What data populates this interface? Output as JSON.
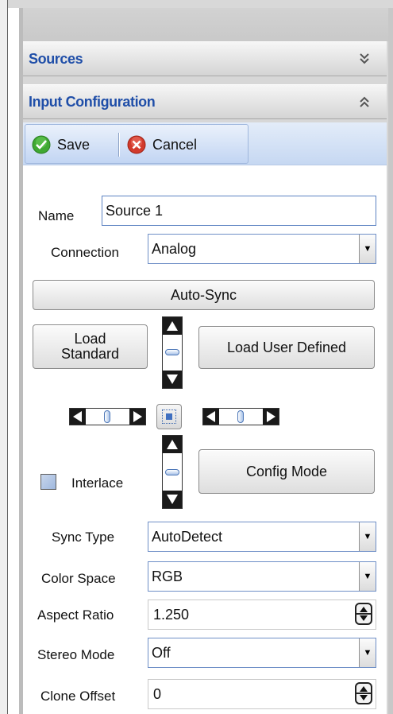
{
  "accordion": {
    "sources": {
      "title": "Sources",
      "icon": "chevron-double-down-icon"
    },
    "input_configuration": {
      "title": "Input Configuration",
      "icon": "chevron-double-up-icon"
    }
  },
  "toolbar": {
    "save_label": "Save",
    "save_icon": "green-check-icon",
    "cancel_label": "Cancel",
    "cancel_icon": "red-x-icon"
  },
  "form": {
    "name_label": "Name",
    "name_value": "Source 1",
    "connection_label": "Connection",
    "connection_value": "Analog",
    "auto_sync_label": "Auto-Sync",
    "load_standard_label_line1": "Load",
    "load_standard_label_line2": "Standard",
    "load_user_defined_label": "Load User Defined",
    "interlace_label": "Interlace",
    "interlace_checked": false,
    "config_mode_label": "Config Mode",
    "sync_type_label": "Sync Type",
    "sync_type_value": "AutoDetect",
    "color_space_label": "Color Space",
    "color_space_value": "RGB",
    "aspect_ratio_label": "Aspect Ratio",
    "aspect_ratio_value": "1.250",
    "stereo_mode_label": "Stereo Mode",
    "stereo_mode_value": "Off",
    "clone_offset_label": "Clone Offset",
    "clone_offset_value": "0"
  },
  "colors": {
    "header_text": "#1f4ea8",
    "toolbar_bg": "#c6d8f2",
    "check_green": "#3fa832",
    "cancel_red": "#d23a2c"
  }
}
